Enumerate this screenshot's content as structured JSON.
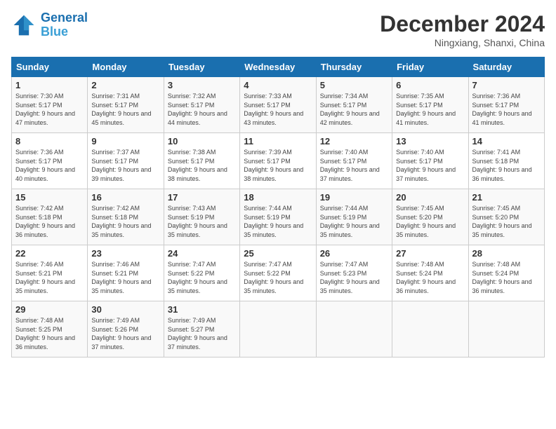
{
  "header": {
    "logo_line1": "General",
    "logo_line2": "Blue",
    "month": "December 2024",
    "location": "Ningxiang, Shanxi, China"
  },
  "weekdays": [
    "Sunday",
    "Monday",
    "Tuesday",
    "Wednesday",
    "Thursday",
    "Friday",
    "Saturday"
  ],
  "weeks": [
    [
      {
        "day": "1",
        "info": "Sunrise: 7:30 AM\nSunset: 5:17 PM\nDaylight: 9 hours and 47 minutes."
      },
      {
        "day": "2",
        "info": "Sunrise: 7:31 AM\nSunset: 5:17 PM\nDaylight: 9 hours and 45 minutes."
      },
      {
        "day": "3",
        "info": "Sunrise: 7:32 AM\nSunset: 5:17 PM\nDaylight: 9 hours and 44 minutes."
      },
      {
        "day": "4",
        "info": "Sunrise: 7:33 AM\nSunset: 5:17 PM\nDaylight: 9 hours and 43 minutes."
      },
      {
        "day": "5",
        "info": "Sunrise: 7:34 AM\nSunset: 5:17 PM\nDaylight: 9 hours and 42 minutes."
      },
      {
        "day": "6",
        "info": "Sunrise: 7:35 AM\nSunset: 5:17 PM\nDaylight: 9 hours and 41 minutes."
      },
      {
        "day": "7",
        "info": "Sunrise: 7:36 AM\nSunset: 5:17 PM\nDaylight: 9 hours and 41 minutes."
      }
    ],
    [
      {
        "day": "8",
        "info": "Sunrise: 7:36 AM\nSunset: 5:17 PM\nDaylight: 9 hours and 40 minutes."
      },
      {
        "day": "9",
        "info": "Sunrise: 7:37 AM\nSunset: 5:17 PM\nDaylight: 9 hours and 39 minutes."
      },
      {
        "day": "10",
        "info": "Sunrise: 7:38 AM\nSunset: 5:17 PM\nDaylight: 9 hours and 38 minutes."
      },
      {
        "day": "11",
        "info": "Sunrise: 7:39 AM\nSunset: 5:17 PM\nDaylight: 9 hours and 38 minutes."
      },
      {
        "day": "12",
        "info": "Sunrise: 7:40 AM\nSunset: 5:17 PM\nDaylight: 9 hours and 37 minutes."
      },
      {
        "day": "13",
        "info": "Sunrise: 7:40 AM\nSunset: 5:17 PM\nDaylight: 9 hours and 37 minutes."
      },
      {
        "day": "14",
        "info": "Sunrise: 7:41 AM\nSunset: 5:18 PM\nDaylight: 9 hours and 36 minutes."
      }
    ],
    [
      {
        "day": "15",
        "info": "Sunrise: 7:42 AM\nSunset: 5:18 PM\nDaylight: 9 hours and 36 minutes."
      },
      {
        "day": "16",
        "info": "Sunrise: 7:42 AM\nSunset: 5:18 PM\nDaylight: 9 hours and 35 minutes."
      },
      {
        "day": "17",
        "info": "Sunrise: 7:43 AM\nSunset: 5:19 PM\nDaylight: 9 hours and 35 minutes."
      },
      {
        "day": "18",
        "info": "Sunrise: 7:44 AM\nSunset: 5:19 PM\nDaylight: 9 hours and 35 minutes."
      },
      {
        "day": "19",
        "info": "Sunrise: 7:44 AM\nSunset: 5:19 PM\nDaylight: 9 hours and 35 minutes."
      },
      {
        "day": "20",
        "info": "Sunrise: 7:45 AM\nSunset: 5:20 PM\nDaylight: 9 hours and 35 minutes."
      },
      {
        "day": "21",
        "info": "Sunrise: 7:45 AM\nSunset: 5:20 PM\nDaylight: 9 hours and 35 minutes."
      }
    ],
    [
      {
        "day": "22",
        "info": "Sunrise: 7:46 AM\nSunset: 5:21 PM\nDaylight: 9 hours and 35 minutes."
      },
      {
        "day": "23",
        "info": "Sunrise: 7:46 AM\nSunset: 5:21 PM\nDaylight: 9 hours and 35 minutes."
      },
      {
        "day": "24",
        "info": "Sunrise: 7:47 AM\nSunset: 5:22 PM\nDaylight: 9 hours and 35 minutes."
      },
      {
        "day": "25",
        "info": "Sunrise: 7:47 AM\nSunset: 5:22 PM\nDaylight: 9 hours and 35 minutes."
      },
      {
        "day": "26",
        "info": "Sunrise: 7:47 AM\nSunset: 5:23 PM\nDaylight: 9 hours and 35 minutes."
      },
      {
        "day": "27",
        "info": "Sunrise: 7:48 AM\nSunset: 5:24 PM\nDaylight: 9 hours and 36 minutes."
      },
      {
        "day": "28",
        "info": "Sunrise: 7:48 AM\nSunset: 5:24 PM\nDaylight: 9 hours and 36 minutes."
      }
    ],
    [
      {
        "day": "29",
        "info": "Sunrise: 7:48 AM\nSunset: 5:25 PM\nDaylight: 9 hours and 36 minutes."
      },
      {
        "day": "30",
        "info": "Sunrise: 7:49 AM\nSunset: 5:26 PM\nDaylight: 9 hours and 37 minutes."
      },
      {
        "day": "31",
        "info": "Sunrise: 7:49 AM\nSunset: 5:27 PM\nDaylight: 9 hours and 37 minutes."
      },
      null,
      null,
      null,
      null
    ]
  ]
}
